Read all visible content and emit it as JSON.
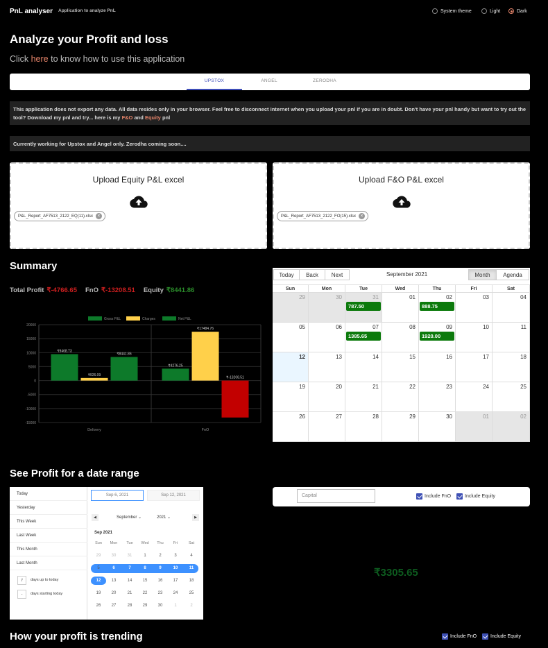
{
  "header": {
    "app_name": "PnL analyser",
    "tagline": "Application to analyze PnL",
    "theme_options": [
      {
        "label": "System theme",
        "selected": false
      },
      {
        "label": "Light",
        "selected": false
      },
      {
        "label": "Dark",
        "selected": true
      }
    ]
  },
  "intro": {
    "title": "Analyze your Profit and loss",
    "howto_prefix": "Click",
    "howto_link": "here",
    "howto_suffix": "to know how to use this application"
  },
  "tabs": [
    {
      "label": "UPSTOX",
      "active": true
    },
    {
      "label": "ANGEL",
      "active": false
    },
    {
      "label": "ZERODHA",
      "active": false
    }
  ],
  "notices": {
    "privacy_text": "This application does not export any data. All data resides only in your browser. Feel free to disconnect internet when you upload your pnl if you are in doubt. Don't have your pnl handy but want to try out the tool? Download my pnl and try... here is my",
    "fno_link": "F&O",
    "and_word": "and",
    "equity_link": "Equity",
    "pnl_word": "pnl",
    "status": "Currently working for Upstox and Angel only. Zerodha coming soon...."
  },
  "uploads": {
    "equity": {
      "title": "Upload Equity P&L excel",
      "file": "P&L_Report_AF7513_2122_EQ(11).xlsx"
    },
    "fno": {
      "title": "Upload F&O P&L excel",
      "file": "P&L_Report_AF7513_2122_FO(15).xlsx"
    }
  },
  "summary": {
    "title": "Summary",
    "total_label": "Total Profit",
    "total_value": "₹-4766.65",
    "fno_label": "FnO",
    "fno_value": "₹-13208.51",
    "equity_label": "Equity",
    "equity_value": "₹8441.86"
  },
  "chart_data": {
    "type": "bar",
    "categories": [
      "Delivery",
      "FnO"
    ],
    "series": [
      {
        "name": "Gross P&L",
        "values": [
          9468.73,
          4276.25
        ],
        "labels": [
          "₹9468.73",
          "₹4276.25"
        ],
        "color": "#0d7a2a"
      },
      {
        "name": "Charges",
        "values": [
          926.09,
          17484.76
        ],
        "labels": [
          "₹926.09",
          "₹17484.76"
        ],
        "color": "#ffd04a"
      },
      {
        "name": "Net P&L",
        "values": [
          8441.86,
          -13208.51
        ],
        "labels": [
          "₹8441.86",
          "₹-13208.51"
        ],
        "color": "#0d7a2a",
        "neg_color": "#c20000"
      }
    ],
    "y_ticks": [
      "20000",
      "15000",
      "10000",
      "5000",
      "0",
      "-5000",
      "-10000",
      "-15000"
    ],
    "ylim": [
      -15000,
      20000
    ],
    "legend": "top"
  },
  "calendar": {
    "buttons": {
      "today": "Today",
      "back": "Back",
      "next": "Next",
      "month": "Month",
      "agenda": "Agenda"
    },
    "label": "September 2021",
    "weekdays": [
      "Sun",
      "Mon",
      "Tue",
      "Wed",
      "Thu",
      "Fri",
      "Sat"
    ],
    "weeks": [
      [
        {
          "d": "29",
          "off": true
        },
        {
          "d": "30",
          "off": true
        },
        {
          "d": "31",
          "off": true,
          "ev": "787.50"
        },
        {
          "d": "01"
        },
        {
          "d": "02",
          "ev": "888.75"
        },
        {
          "d": "03"
        },
        {
          "d": "04"
        }
      ],
      [
        {
          "d": "05"
        },
        {
          "d": "06"
        },
        {
          "d": "07",
          "ev": "1385.65"
        },
        {
          "d": "08"
        },
        {
          "d": "09",
          "ev": "1920.00"
        },
        {
          "d": "10"
        },
        {
          "d": "11"
        }
      ],
      [
        {
          "d": "12",
          "today": true
        },
        {
          "d": "13"
        },
        {
          "d": "14"
        },
        {
          "d": "15"
        },
        {
          "d": "16"
        },
        {
          "d": "17"
        },
        {
          "d": "18"
        }
      ],
      [
        {
          "d": "19"
        },
        {
          "d": "20"
        },
        {
          "d": "21"
        },
        {
          "d": "22"
        },
        {
          "d": "23"
        },
        {
          "d": "24"
        },
        {
          "d": "25"
        }
      ],
      [
        {
          "d": "26"
        },
        {
          "d": "27"
        },
        {
          "d": "28"
        },
        {
          "d": "29"
        },
        {
          "d": "30"
        },
        {
          "d": "01",
          "off": true
        },
        {
          "d": "02",
          "off": true
        }
      ]
    ]
  },
  "range_section": {
    "title": "See Profit for a date range",
    "presets": [
      "Today",
      "Yesterday",
      "This Week",
      "Last Week",
      "This Month",
      "Last Month"
    ],
    "days_up_value": "7",
    "days_up_label": "days up to today",
    "days_start_value": "-",
    "days_start_label": "days starting today",
    "start_date": "Sep 6, 2021",
    "end_date": "Sep 12, 2021",
    "month_select": "September",
    "year_select": "2021",
    "month_title": "Sep 2021",
    "weekdays": [
      "Sun",
      "Mon",
      "Tue",
      "Wed",
      "Thu",
      "Fri",
      "Sat"
    ],
    "days": [
      [
        "29",
        "30",
        "31",
        "1",
        "2",
        "3",
        "4"
      ],
      [
        "5",
        "6",
        "7",
        "8",
        "9",
        "10",
        "11"
      ],
      [
        "12",
        "13",
        "14",
        "15",
        "16",
        "17",
        "18"
      ],
      [
        "19",
        "20",
        "21",
        "22",
        "23",
        "24",
        "25"
      ],
      [
        "26",
        "27",
        "28",
        "29",
        "30",
        "1",
        "2"
      ]
    ],
    "capital_placeholder": "Capital",
    "include_fno": "Include FnO",
    "include_equity": "Include Equity",
    "range_profit": "₹3305.65"
  },
  "trend": {
    "title": "How your profit is trending",
    "include_fno": "Include FnO",
    "include_equity": "Include Equity"
  }
}
